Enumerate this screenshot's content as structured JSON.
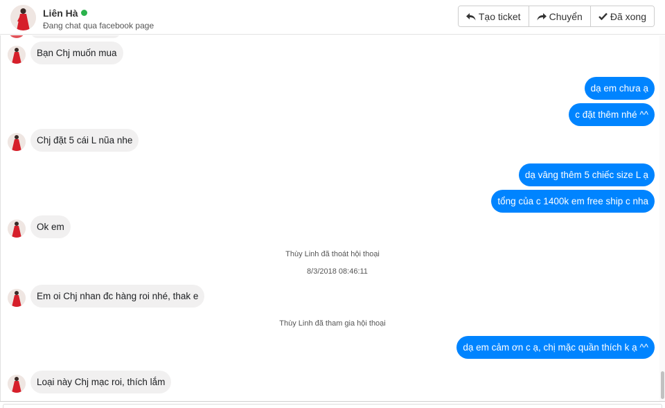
{
  "header": {
    "contact_name": "Liên Hà",
    "status": "online",
    "subtitle": "Đang chat qua facebook page",
    "actions": [
      {
        "label": "Tạo ticket",
        "icon": "reply-icon"
      },
      {
        "label": "Chuyển",
        "icon": "forward-icon"
      },
      {
        "label": "Đã xong",
        "icon": "check-icon"
      }
    ]
  },
  "colors": {
    "outgoing_bubble": "#0084ff",
    "incoming_bubble": "#f1f0f0",
    "online_dot": "#2bb24c"
  },
  "messages": [
    {
      "dir": "in",
      "text": "Bạn Chj muốn mua"
    },
    {
      "dir": "out",
      "text": "dạ em chưa ạ"
    },
    {
      "dir": "out",
      "text": "c đặt thêm nhé ^^"
    },
    {
      "dir": "in",
      "text": "Chj đặt 5 cái L nũa nhe"
    },
    {
      "dir": "out",
      "text": "dạ vâng thêm 5 chiếc size L ạ"
    },
    {
      "dir": "out",
      "text": "tổng của c 1400k em free ship c nha"
    },
    {
      "dir": "in",
      "text": "Ok em"
    },
    {
      "dir": "system",
      "text": "Thùy Linh đã thoát hội thoại"
    },
    {
      "dir": "timestamp",
      "text": "8/3/2018 08:46:11"
    },
    {
      "dir": "in",
      "text": "Em oi Chj nhan đc hàng roi nhé, thak e"
    },
    {
      "dir": "system",
      "text": "Thùy Linh đã tham gia hội thoại"
    },
    {
      "dir": "out",
      "text": "dạ em cảm ơn c ạ, chị mặc quần thích k ạ ^^"
    },
    {
      "dir": "in",
      "text": "Loại này Chj mạc roi, thích lắm"
    }
  ]
}
